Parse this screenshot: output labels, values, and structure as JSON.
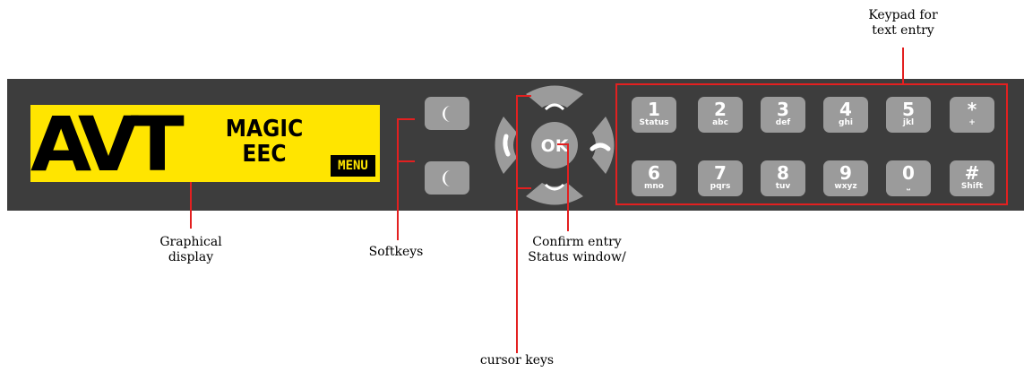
{
  "display": {
    "logo": "AVT",
    "model_line1": "MAGIC",
    "model_line2": "EEC",
    "menu": "MENU"
  },
  "cursor": {
    "ok": "OK"
  },
  "keypad": {
    "row1": [
      {
        "main": "1",
        "sub": "Status"
      },
      {
        "main": "2",
        "sub": "abc"
      },
      {
        "main": "3",
        "sub": "def"
      },
      {
        "main": "4",
        "sub": "ghi"
      },
      {
        "main": "5",
        "sub": "jkl"
      },
      {
        "main": "*",
        "sub": "+"
      }
    ],
    "row2": [
      {
        "main": "6",
        "sub": "mno"
      },
      {
        "main": "7",
        "sub": "pqrs"
      },
      {
        "main": "8",
        "sub": "tuv"
      },
      {
        "main": "9",
        "sub": "wxyz"
      },
      {
        "main": "0",
        "sub": "⎵"
      },
      {
        "main": "#",
        "sub": "Shift"
      }
    ]
  },
  "labels": {
    "keypad_line1": "Keypad for",
    "keypad_line2": "text entry",
    "graphical_line1": "Graphical",
    "graphical_line2": "display",
    "softkeys": "Softkeys",
    "confirm_line1": "Confirm entry",
    "confirm_line2": "Status window/",
    "cursor_keys": "cursor keys"
  },
  "colors": {
    "panel": "#3d3d3d",
    "display": "#ffe500",
    "keys": "#9b9b9b",
    "callout": "#e32020"
  }
}
